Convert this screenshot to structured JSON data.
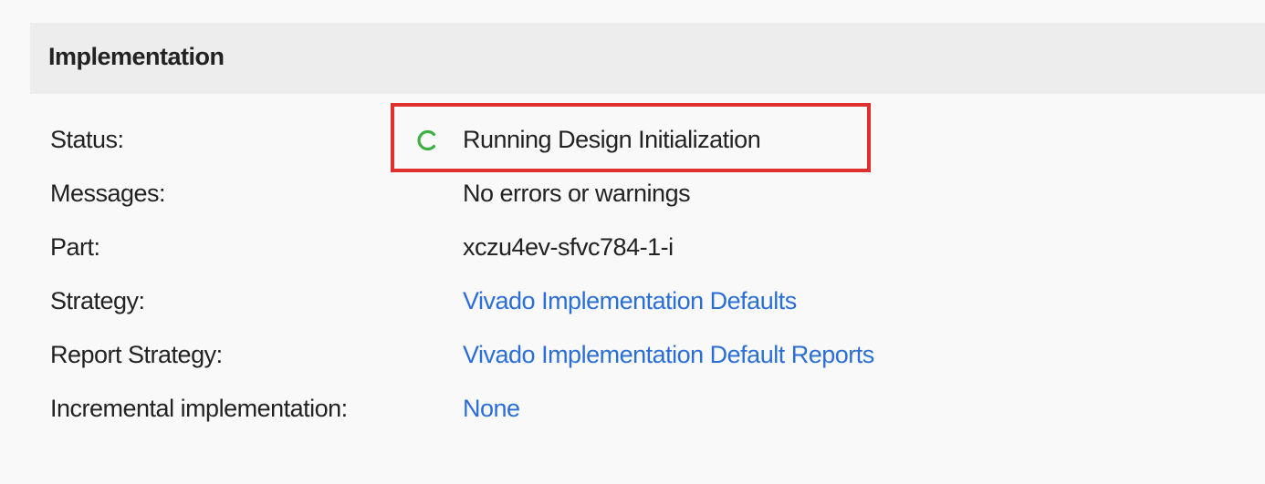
{
  "panel": {
    "title": "Implementation"
  },
  "rows": [
    {
      "label": "Status:",
      "value": "Running Design Initialization",
      "link": false
    },
    {
      "label": "Messages:",
      "value": "No errors or warnings",
      "link": false
    },
    {
      "label": "Part:",
      "value": "xczu4ev-sfvc784-1-i",
      "link": false
    },
    {
      "label": "Strategy:",
      "value": "Vivado Implementation Defaults",
      "link": true
    },
    {
      "label": "Report Strategy:",
      "value": "Vivado Implementation Default Reports",
      "link": true
    },
    {
      "label": "Incremental implementation:",
      "value": "None",
      "link": true
    }
  ],
  "icons": {
    "status": "spinner-icon"
  },
  "colors": {
    "link": "#2a6ed8",
    "highlight_border": "#e0302e",
    "spinner": "#3cb043",
    "header_bg": "#ededed"
  }
}
